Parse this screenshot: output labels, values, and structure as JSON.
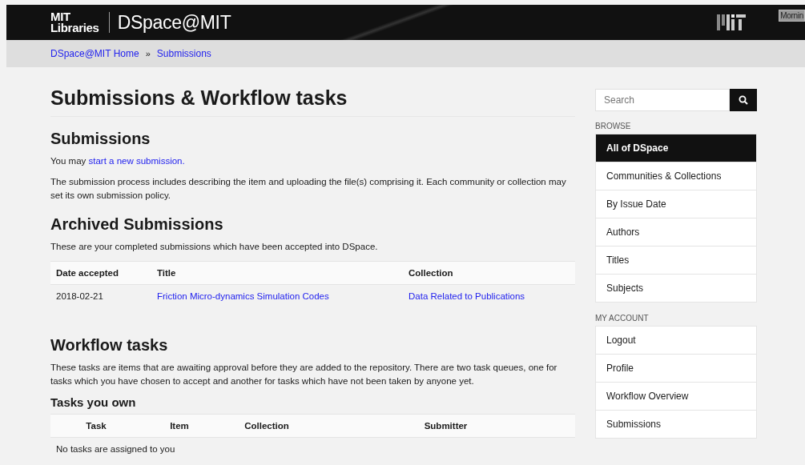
{
  "header": {
    "logo_line_1": "MIT",
    "logo_line_2": "Libraries",
    "site_title": "DSpace@MIT",
    "user_badge": "Mornin"
  },
  "breadcrumbs": [
    "DSpace@MIT Home",
    "Submissions"
  ],
  "breadcrumb_separator": "»",
  "page_title": "Submissions & Workflow tasks",
  "submissions": {
    "heading": "Submissions",
    "intro_prefix": "You may ",
    "intro_link": "start a new submission.",
    "description": "The submission process includes describing the item and uploading the file(s) comprising it. Each community or collection may set its own submission policy."
  },
  "archived": {
    "heading": "Archived Submissions",
    "description": "These are your completed submissions which have been accepted into DSpace.",
    "columns": [
      "Date accepted",
      "Title",
      "Collection"
    ],
    "rows": [
      {
        "date": "2018-02-21",
        "title": "Friction Micro-dynamics Simulation Codes",
        "collection": "Data Related to Publications"
      }
    ]
  },
  "workflow": {
    "heading": "Workflow tasks",
    "description": "These tasks are items that are awaiting approval before they are added to the repository. There are two task queues, one for tasks which you have chosen to accept and another for tasks which have not been taken by anyone yet.",
    "subheading": "Tasks you own",
    "columns": [
      "Task",
      "Item",
      "Collection",
      "Submitter"
    ],
    "empty_message": "No tasks are assigned to you"
  },
  "sidebar": {
    "search": {
      "placeholder": "Search"
    },
    "sections": [
      {
        "heading": "BROWSE",
        "items": [
          {
            "label": "All of DSpace",
            "selected": true
          },
          {
            "label": "Communities & Collections",
            "selected": false
          },
          {
            "label": "By Issue Date",
            "selected": false
          },
          {
            "label": "Authors",
            "selected": false
          },
          {
            "label": "Titles",
            "selected": false
          },
          {
            "label": "Subjects",
            "selected": false
          }
        ]
      },
      {
        "heading": "MY ACCOUNT",
        "items": [
          {
            "label": "Logout",
            "selected": false
          },
          {
            "label": "Profile",
            "selected": false
          },
          {
            "label": "Workflow Overview",
            "selected": false
          },
          {
            "label": "Submissions",
            "selected": false
          }
        ]
      }
    ]
  }
}
